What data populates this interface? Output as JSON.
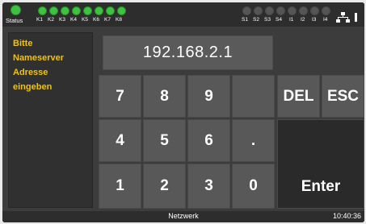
{
  "status": {
    "label": "Status",
    "inputs_k": [
      "K1",
      "K2",
      "K3",
      "K4",
      "K5",
      "K6",
      "K7",
      "K8"
    ],
    "inputs_s": [
      "S1",
      "S2",
      "S3",
      "S4",
      "I1",
      "I2",
      "I3",
      "I4"
    ],
    "k_led_state": "on",
    "s_led_state": "off",
    "status_led_state": "on",
    "led_on_color": "#3fc23f",
    "led_off_color": "#555555",
    "network_icon": "network-icon"
  },
  "prompt": {
    "lines": [
      "Bitte",
      "Nameserver",
      "Adresse",
      "eingeben"
    ],
    "color": "#f2c400"
  },
  "display": {
    "value": "192.168.2.1"
  },
  "keypad": {
    "row1": [
      "7",
      "8",
      "9",
      ""
    ],
    "row2": [
      "4",
      "5",
      "6",
      "."
    ],
    "row3": [
      "1",
      "2",
      "3",
      "0"
    ],
    "del": "DEL",
    "esc": "ESC",
    "enter": "Enter"
  },
  "bottombar": {
    "title": "Netzwerk",
    "time": "10:40:36"
  }
}
